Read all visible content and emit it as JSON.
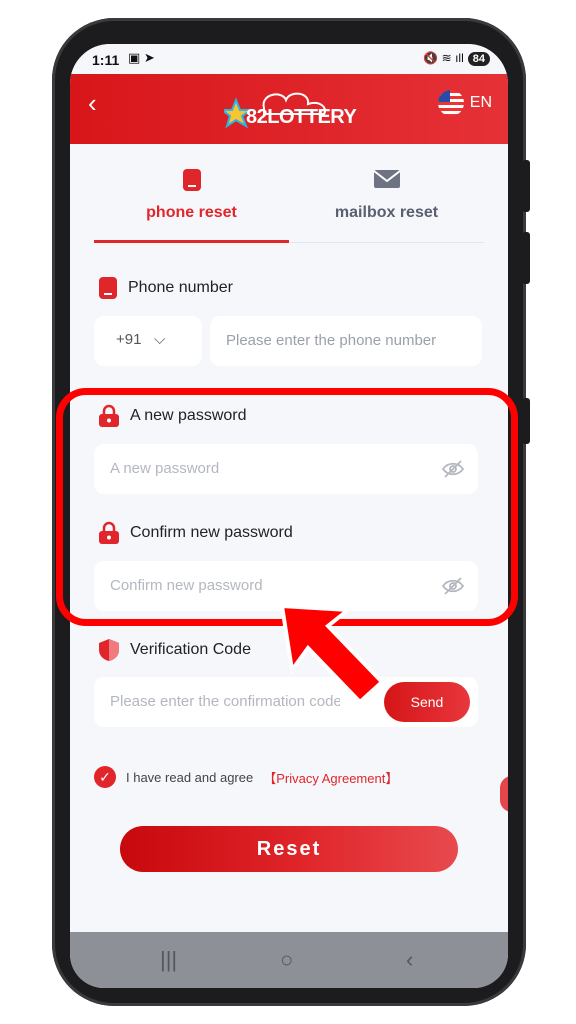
{
  "status_bar": {
    "time": "1:11",
    "battery": "84"
  },
  "header": {
    "logo_text": "82LOTTERY",
    "language": "EN"
  },
  "tabs": [
    {
      "label": "phone reset",
      "active": true,
      "icon": "phone-icon"
    },
    {
      "label": "mailbox reset",
      "active": false,
      "icon": "mail-icon"
    }
  ],
  "phone": {
    "label": "Phone number",
    "country_code": "+91",
    "placeholder": "Please enter the phone number"
  },
  "new_password": {
    "label": "A new password",
    "placeholder": "A new password"
  },
  "confirm_password": {
    "label": "Confirm new password",
    "placeholder": "Confirm new password"
  },
  "verification": {
    "label": "Verification Code",
    "placeholder": "Please enter the confirmation code",
    "send_label": "Send"
  },
  "agreement": {
    "text": "I have read and agree",
    "link": "【Privacy Agreement】"
  },
  "reset_label": "Reset",
  "colors": {
    "accent": "#e0262b",
    "annotation": "#ff0000"
  }
}
